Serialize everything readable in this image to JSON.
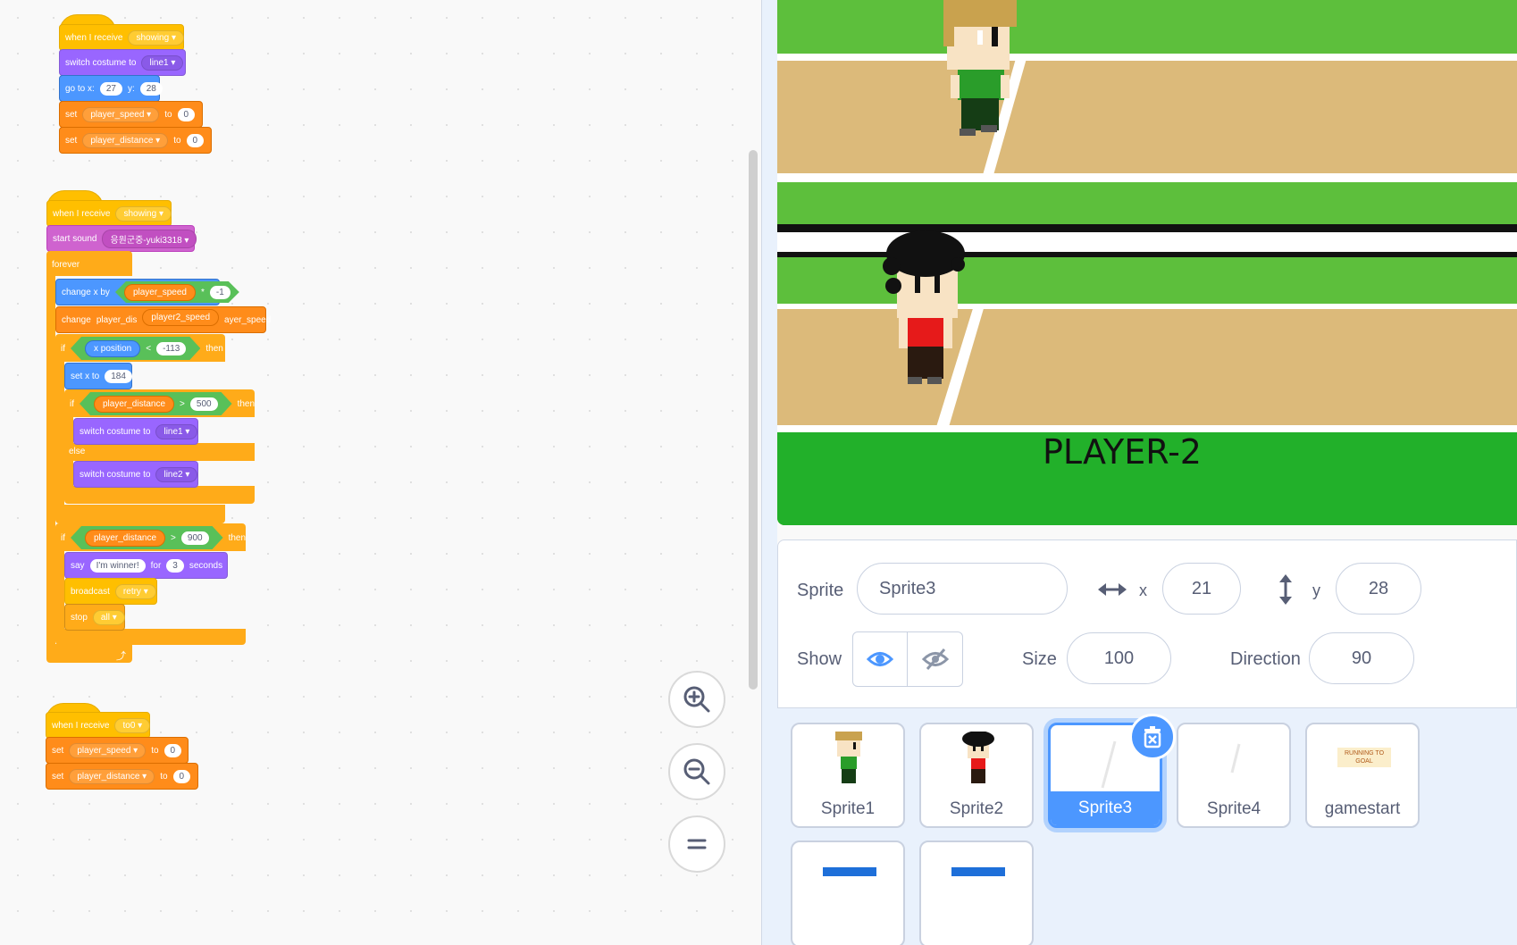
{
  "scripts": {
    "script1": {
      "hat": {
        "label": "when I receive",
        "msg": "showing"
      },
      "costume": {
        "label": "switch costume to",
        "value": "line1"
      },
      "goto": {
        "label": "go to x:",
        "x": "27",
        "ylabel": "y:",
        "y": "28"
      },
      "set1": {
        "label": "set",
        "var": "player_speed",
        "to": "to",
        "value": "0"
      },
      "set2": {
        "label": "set",
        "var": "player_distance",
        "to": "to",
        "value": "0"
      }
    },
    "script2": {
      "hat": {
        "label": "when I receive",
        "msg": "showing"
      },
      "sound": {
        "label": "start sound",
        "value": "응원군중-yuki3318"
      },
      "forever": "forever",
      "changex": {
        "label": "change x by",
        "var": "player_speed",
        "op": "*",
        "value": "-1"
      },
      "changevar": {
        "label": "change",
        "var_a": "player_dis",
        "var_b": "player2_speed",
        "var_c": "ayer_speed"
      },
      "if1": {
        "label": "if",
        "reporter": "x position",
        "op": "<",
        "value": "-113",
        "then": "then"
      },
      "setx": {
        "label": "set x to",
        "value": "184"
      },
      "if2": {
        "label": "if",
        "reporter": "player_distance",
        "op": ">",
        "value": "500",
        "then": "then"
      },
      "costume1": {
        "label": "switch costume to",
        "value": "line1"
      },
      "else": "else",
      "costume2": {
        "label": "switch costume to",
        "value": "line2"
      },
      "if3": {
        "label": "if",
        "reporter": "player_distance",
        "op": ">",
        "value": "900",
        "then": "then"
      },
      "say": {
        "label": "say",
        "text": "I'm winner!",
        "for": "for",
        "secs": "3",
        "seconds": "seconds"
      },
      "broadcast": {
        "label": "broadcast",
        "value": "retry"
      },
      "stop": {
        "label": "stop",
        "value": "all"
      }
    },
    "script3": {
      "hat": {
        "label": "when I receive",
        "msg": "to0"
      },
      "set1": {
        "label": "set",
        "var": "player_speed",
        "to": "to",
        "value": "0"
      },
      "set2": {
        "label": "set",
        "var": "player_distance",
        "to": "to",
        "value": "0"
      }
    }
  },
  "zoom": {
    "in_icon": "zoom-in-icon",
    "out_icon": "zoom-out-icon",
    "reset_icon": "zoom-reset-icon"
  },
  "stage": {
    "label": "PLAYER-2"
  },
  "sprite_info": {
    "sprite_label": "Sprite",
    "sprite_name": "Sprite3",
    "x_label": "x",
    "x": "21",
    "y_label": "y",
    "y": "28",
    "show_label": "Show",
    "size_label": "Size",
    "size": "100",
    "direction_label": "Direction",
    "direction": "90"
  },
  "sprites": [
    {
      "name": "Sprite1"
    },
    {
      "name": "Sprite2"
    },
    {
      "name": "Sprite3",
      "selected": true
    },
    {
      "name": "Sprite4"
    },
    {
      "name": "gamestart",
      "thumb_text": "RUNNING TO GOAL"
    }
  ],
  "colors": {
    "events": "#ffbf00",
    "looks": "#9966ff",
    "motion": "#4c97ff",
    "variables": "#ff8c1a",
    "sound": "#cf63cf",
    "control": "#ffab19",
    "operators": "#59c059",
    "accent": "#4c97ff"
  }
}
